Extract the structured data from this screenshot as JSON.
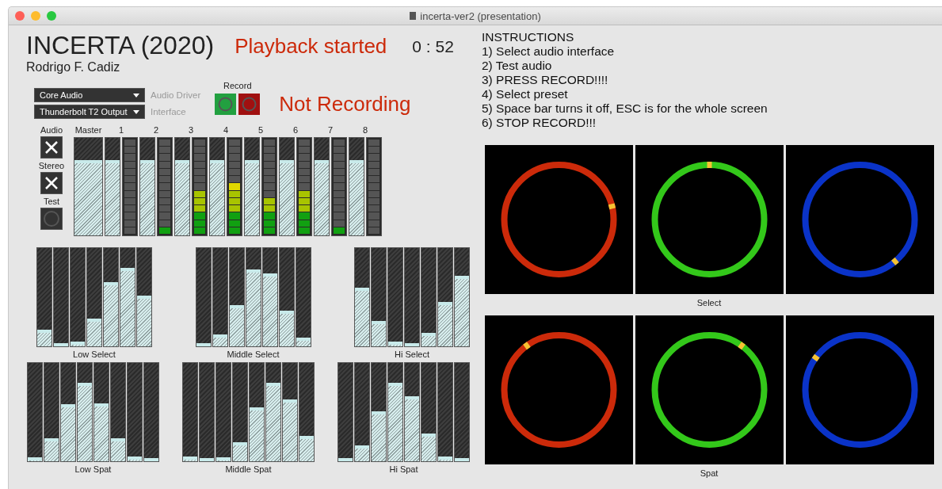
{
  "window": {
    "title": "incerta-ver2 (presentation)"
  },
  "header": {
    "title": "INCERTA (2020)",
    "author": "Rodrigo F. Cadiz",
    "status": "Playback started",
    "time": "0 : 52"
  },
  "dropdowns": [
    {
      "value": "Core Audio",
      "label": "Audio Driver"
    },
    {
      "value": "Thunderbolt T2 Output",
      "label": "Interface"
    }
  ],
  "record": {
    "label": "Record",
    "status": "Not Recording"
  },
  "toggles": [
    {
      "label": "Audio",
      "kind": "cross"
    },
    {
      "label": "Stereo",
      "kind": "cross"
    },
    {
      "label": "Test",
      "kind": "ring"
    }
  ],
  "mixer": {
    "master": {
      "label": "Master",
      "level": 0.77
    },
    "channels": [
      {
        "label": "1",
        "level": 0.77,
        "meter": {
          "level": 0
        }
      },
      {
        "label": "2",
        "level": 0.77,
        "meter": {
          "level": 0.08
        }
      },
      {
        "label": "3",
        "level": 0.77,
        "meter": {
          "level": 0.46
        }
      },
      {
        "label": "4",
        "level": 0.77,
        "meter": {
          "level": 0.54
        }
      },
      {
        "label": "5",
        "level": 0.77,
        "meter": {
          "level": 0.38
        }
      },
      {
        "label": "6",
        "level": 0.77,
        "meter": {
          "level": 0.46
        }
      },
      {
        "label": "7",
        "level": 0.77,
        "meter": {
          "level": 0.08
        }
      },
      {
        "label": "8",
        "level": 0.77,
        "meter": {
          "level": 0
        }
      }
    ]
  },
  "slider_groups": [
    {
      "label": "Low Select",
      "sliders": [
        {
          "level": 0.17
        },
        {
          "level": 0.03
        },
        {
          "level": 0.05
        },
        {
          "level": 0.28
        },
        {
          "level": 0.65
        },
        {
          "level": 0.8
        },
        {
          "level": 0.52
        }
      ]
    },
    {
      "label": "Middle Select",
      "sliders": [
        {
          "level": 0.03
        },
        {
          "level": 0.12
        },
        {
          "level": 0.42
        },
        {
          "level": 0.78
        },
        {
          "level": 0.74
        },
        {
          "level": 0.36
        },
        {
          "level": 0.09
        }
      ]
    },
    {
      "label": "Hi Select",
      "sliders": [
        {
          "level": 0.6
        },
        {
          "level": 0.26
        },
        {
          "level": 0.05
        },
        {
          "level": 0.03
        },
        {
          "level": 0.14
        },
        {
          "level": 0.45
        },
        {
          "level": 0.72
        }
      ]
    },
    {
      "label": "Low Spat",
      "sliders": [
        {
          "level": 0.04
        },
        {
          "level": 0.23
        },
        {
          "level": 0.58
        },
        {
          "level": 0.8
        },
        {
          "level": 0.59
        },
        {
          "level": 0.23
        },
        {
          "level": 0.05
        },
        {
          "level": 0
        }
      ]
    },
    {
      "label": "Middle Spat",
      "sliders": [
        {
          "level": 0.05
        },
        {
          "level": 0
        },
        {
          "level": 0.04
        },
        {
          "level": 0.19
        },
        {
          "level": 0.55
        },
        {
          "level": 0.8
        },
        {
          "level": 0.63
        },
        {
          "level": 0.26
        }
      ]
    },
    {
      "label": "Hi Spat",
      "sliders": [
        {
          "level": 0.03
        },
        {
          "level": 0.16
        },
        {
          "level": 0.51
        },
        {
          "level": 0.8
        },
        {
          "level": 0.66
        },
        {
          "level": 0.28
        },
        {
          "level": 0.05
        },
        {
          "level": 0
        }
      ]
    }
  ],
  "instructions": [
    "INSTRUCTIONS",
    "1) Select audio interface",
    "2) Test audio",
    "3) PRESS RECORD!!!!",
    "4) Select preset",
    "5) Space bar turns it off, ESC is for the whole screen",
    "6) STOP RECORD!!!"
  ],
  "dial_rows": [
    {
      "label": "Select",
      "dials": [
        {
          "color": "#cc2a0a"
        },
        {
          "color": "#33c81a"
        },
        {
          "color": "#0a33c8"
        }
      ]
    },
    {
      "label": "Spat",
      "dials": [
        {
          "color": "#cc2a0a"
        },
        {
          "color": "#33c81a"
        },
        {
          "color": "#0a33c8"
        }
      ]
    }
  ]
}
